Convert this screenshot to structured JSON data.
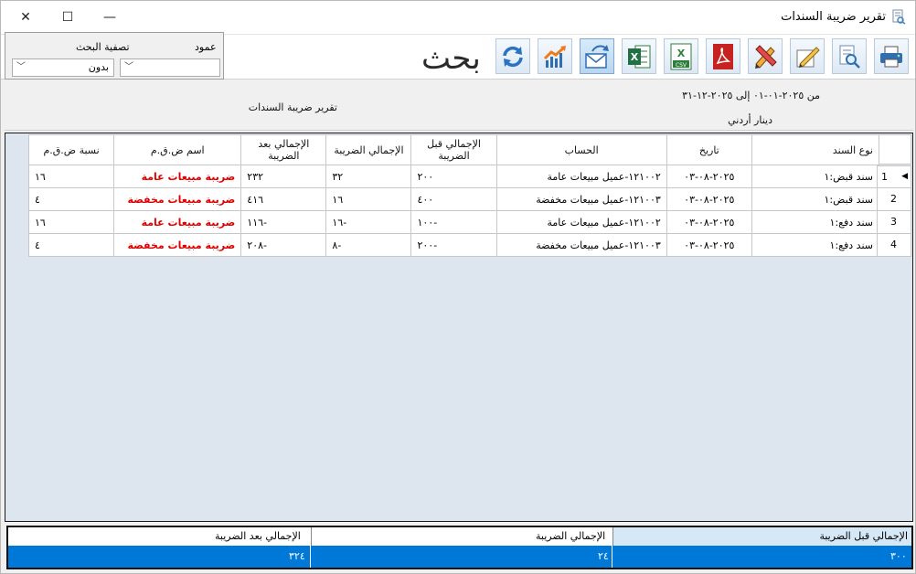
{
  "window": {
    "title": "تقرير ضريبة السندات",
    "controls": {
      "minimize": "—",
      "maximize": "☐",
      "close": "✕"
    }
  },
  "toolbar": {
    "search_label": "بحث",
    "buttons": [
      {
        "name": "print-button",
        "icon": "printer-icon"
      },
      {
        "name": "preview-button",
        "icon": "search-document-icon"
      },
      {
        "name": "design-button",
        "icon": "edit-ruler-icon"
      },
      {
        "name": "tools-button",
        "icon": "pencil-ruler-icon"
      },
      {
        "name": "export-pdf-button",
        "icon": "pdf-icon"
      },
      {
        "name": "export-csv-button",
        "icon": "csv-icon"
      },
      {
        "name": "export-excel-button",
        "icon": "excel-icon"
      },
      {
        "name": "send-email-button",
        "icon": "email-send-icon"
      },
      {
        "name": "chart-button",
        "icon": "chart-up-icon"
      },
      {
        "name": "refresh-button",
        "icon": "refresh-icon"
      }
    ]
  },
  "filter": {
    "column_label": "عمود",
    "column_value": "",
    "search_filter_label": "تصفية البحث",
    "search_filter_value": "بدون"
  },
  "report_header": {
    "date_range": "من ٢٠٢٥-٠١-٠١ إلى ٢٠٢٥-١٢-٣١",
    "currency": "دينار أردني",
    "report_title": "تقرير ضريبة السندات"
  },
  "grid": {
    "columns": [
      "نوع السند",
      "تاريخ",
      "الحساب",
      "الإجمالي قبل الضريبة",
      "الإجمالي الضريبة",
      "الإجمالي بعد الضريبة",
      "اسم ض.ق.م",
      "نسبة ض.ق.م"
    ],
    "rows": [
      {
        "num": "1",
        "type": "سند قبض:١",
        "date": "٢٠٢٥-٠٨-٠٣",
        "account": "١٢١٠٠٢-عميل مبيعات عامة",
        "before_tax": "٢٠٠",
        "tax": "٣٢",
        "after_tax": "٢٣٢",
        "vat_name": "ضريبة مبيعات عامة",
        "vat_rate": "١٦"
      },
      {
        "num": "2",
        "type": "سند قبض:١",
        "date": "٢٠٢٥-٠٨-٠٣",
        "account": "١٢١٠٠٣-عميل مبيعات مخفضة",
        "before_tax": "٤٠٠",
        "tax": "١٦",
        "after_tax": "٤١٦",
        "vat_name": "ضريبة مبيعات مخفضة",
        "vat_rate": "٤"
      },
      {
        "num": "3",
        "type": "سند دفع:١",
        "date": "٢٠٢٥-٠٨-٠٣",
        "account": "١٢١٠٠٢-عميل مبيعات عامة",
        "before_tax": "-١٠٠",
        "tax": "-١٦",
        "after_tax": "-١١٦",
        "vat_name": "ضريبة مبيعات عامة",
        "vat_rate": "١٦"
      },
      {
        "num": "4",
        "type": "سند دفع:١",
        "date": "٢٠٢٥-٠٨-٠٣",
        "account": "١٢١٠٠٣-عميل مبيعات مخفضة",
        "before_tax": "-٢٠٠",
        "tax": "-٨",
        "after_tax": "-٢٠٨",
        "vat_name": "ضريبة مبيعات مخفضة",
        "vat_rate": "٤"
      }
    ]
  },
  "totals": {
    "before_tax_label": "الإجمالي قبل الضريبة",
    "tax_label": "الإجمالي الضريبة",
    "after_tax_label": "الإجمالي بعد الضريبة",
    "before_tax_value": "٣٠٠",
    "tax_value": "٢٤",
    "after_tax_value": "٣٢٤"
  },
  "colors": {
    "selection": "#0078d7",
    "accent_red": "#e00000"
  }
}
